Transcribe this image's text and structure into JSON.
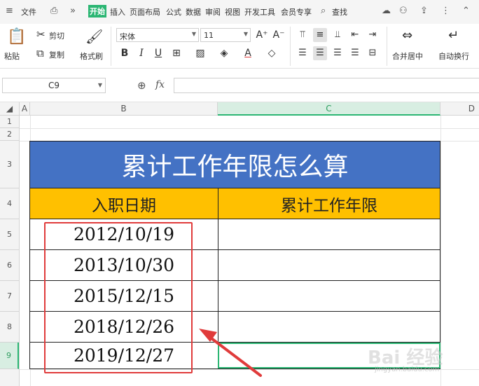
{
  "menubar": {
    "file": "文件",
    "tabs": [
      {
        "label": "开始",
        "active": true
      },
      {
        "label": "插入"
      },
      {
        "label": "页面布局"
      },
      {
        "label": "公式"
      },
      {
        "label": "数据"
      },
      {
        "label": "审阅"
      },
      {
        "label": "视图"
      },
      {
        "label": "开发工具"
      },
      {
        "label": "会员专享"
      }
    ],
    "search": "查找"
  },
  "ribbon": {
    "paste": "粘贴",
    "cut": "剪切",
    "copy": "复制",
    "format_painter": "格式刷",
    "font_name": "宋体",
    "font_size": "11",
    "merge_center": "合并居中",
    "auto_wrap": "自动换行"
  },
  "formula_bar": {
    "name_box": "C9",
    "fx": "fx",
    "value": ""
  },
  "columns": [
    "A",
    "B",
    "C",
    "D"
  ],
  "rows": [
    "1",
    "2",
    "3",
    "4",
    "5",
    "6",
    "7",
    "8",
    "9"
  ],
  "table": {
    "title": "累计工作年限怎么算",
    "header_b": "入职日期",
    "header_c": "累计工作年限",
    "dates": [
      "2012/10/19",
      "2013/10/30",
      "2015/12/15",
      "2018/12/26",
      "2019/12/27"
    ]
  },
  "watermark": {
    "brand": "Bai 经验",
    "url": "jingyan.baidu.com"
  },
  "colors": {
    "title_bg": "#4472c4",
    "header_bg": "#ffc000",
    "selection": "#2bb673",
    "annotation": "#e03b3b"
  }
}
